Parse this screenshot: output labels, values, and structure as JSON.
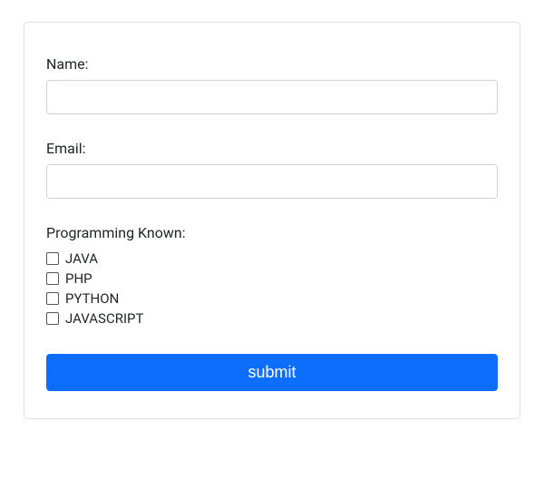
{
  "form": {
    "name": {
      "label": "Name:",
      "value": ""
    },
    "email": {
      "label": "Email:",
      "value": ""
    },
    "programming": {
      "label": "Programming Known:",
      "options": [
        {
          "label": "JAVA",
          "checked": false
        },
        {
          "label": "PHP",
          "checked": false
        },
        {
          "label": "PYTHON",
          "checked": false
        },
        {
          "label": "JAVASCRIPT",
          "checked": false
        }
      ]
    },
    "submit_label": "submit"
  }
}
